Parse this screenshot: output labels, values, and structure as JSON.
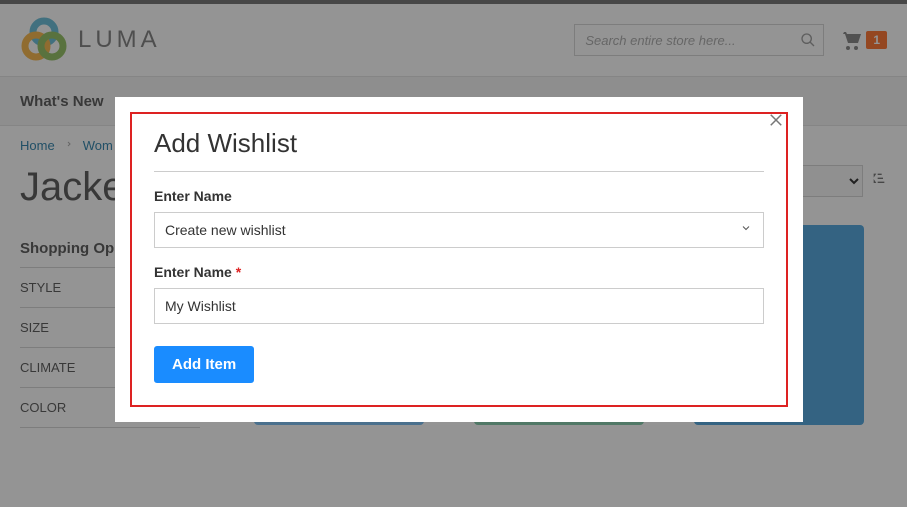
{
  "brand": "LUMA",
  "search": {
    "placeholder": "Search entire store here..."
  },
  "cart": {
    "count": "1"
  },
  "nav": {
    "item0": "What's New"
  },
  "crumbs": {
    "home": "Home",
    "c1": "Wom"
  },
  "page_title": "Jacket",
  "sidebar": {
    "title": "Shopping Op",
    "filters": [
      "STYLE",
      "SIZE",
      "CLIMATE",
      "COLOR"
    ]
  },
  "modal": {
    "title": "Add Wishlist",
    "label_select": "Enter Name",
    "select_value": "Create new wishlist",
    "label_name": "Enter Name",
    "name_value": "My Wishlist",
    "submit": "Add Item"
  }
}
